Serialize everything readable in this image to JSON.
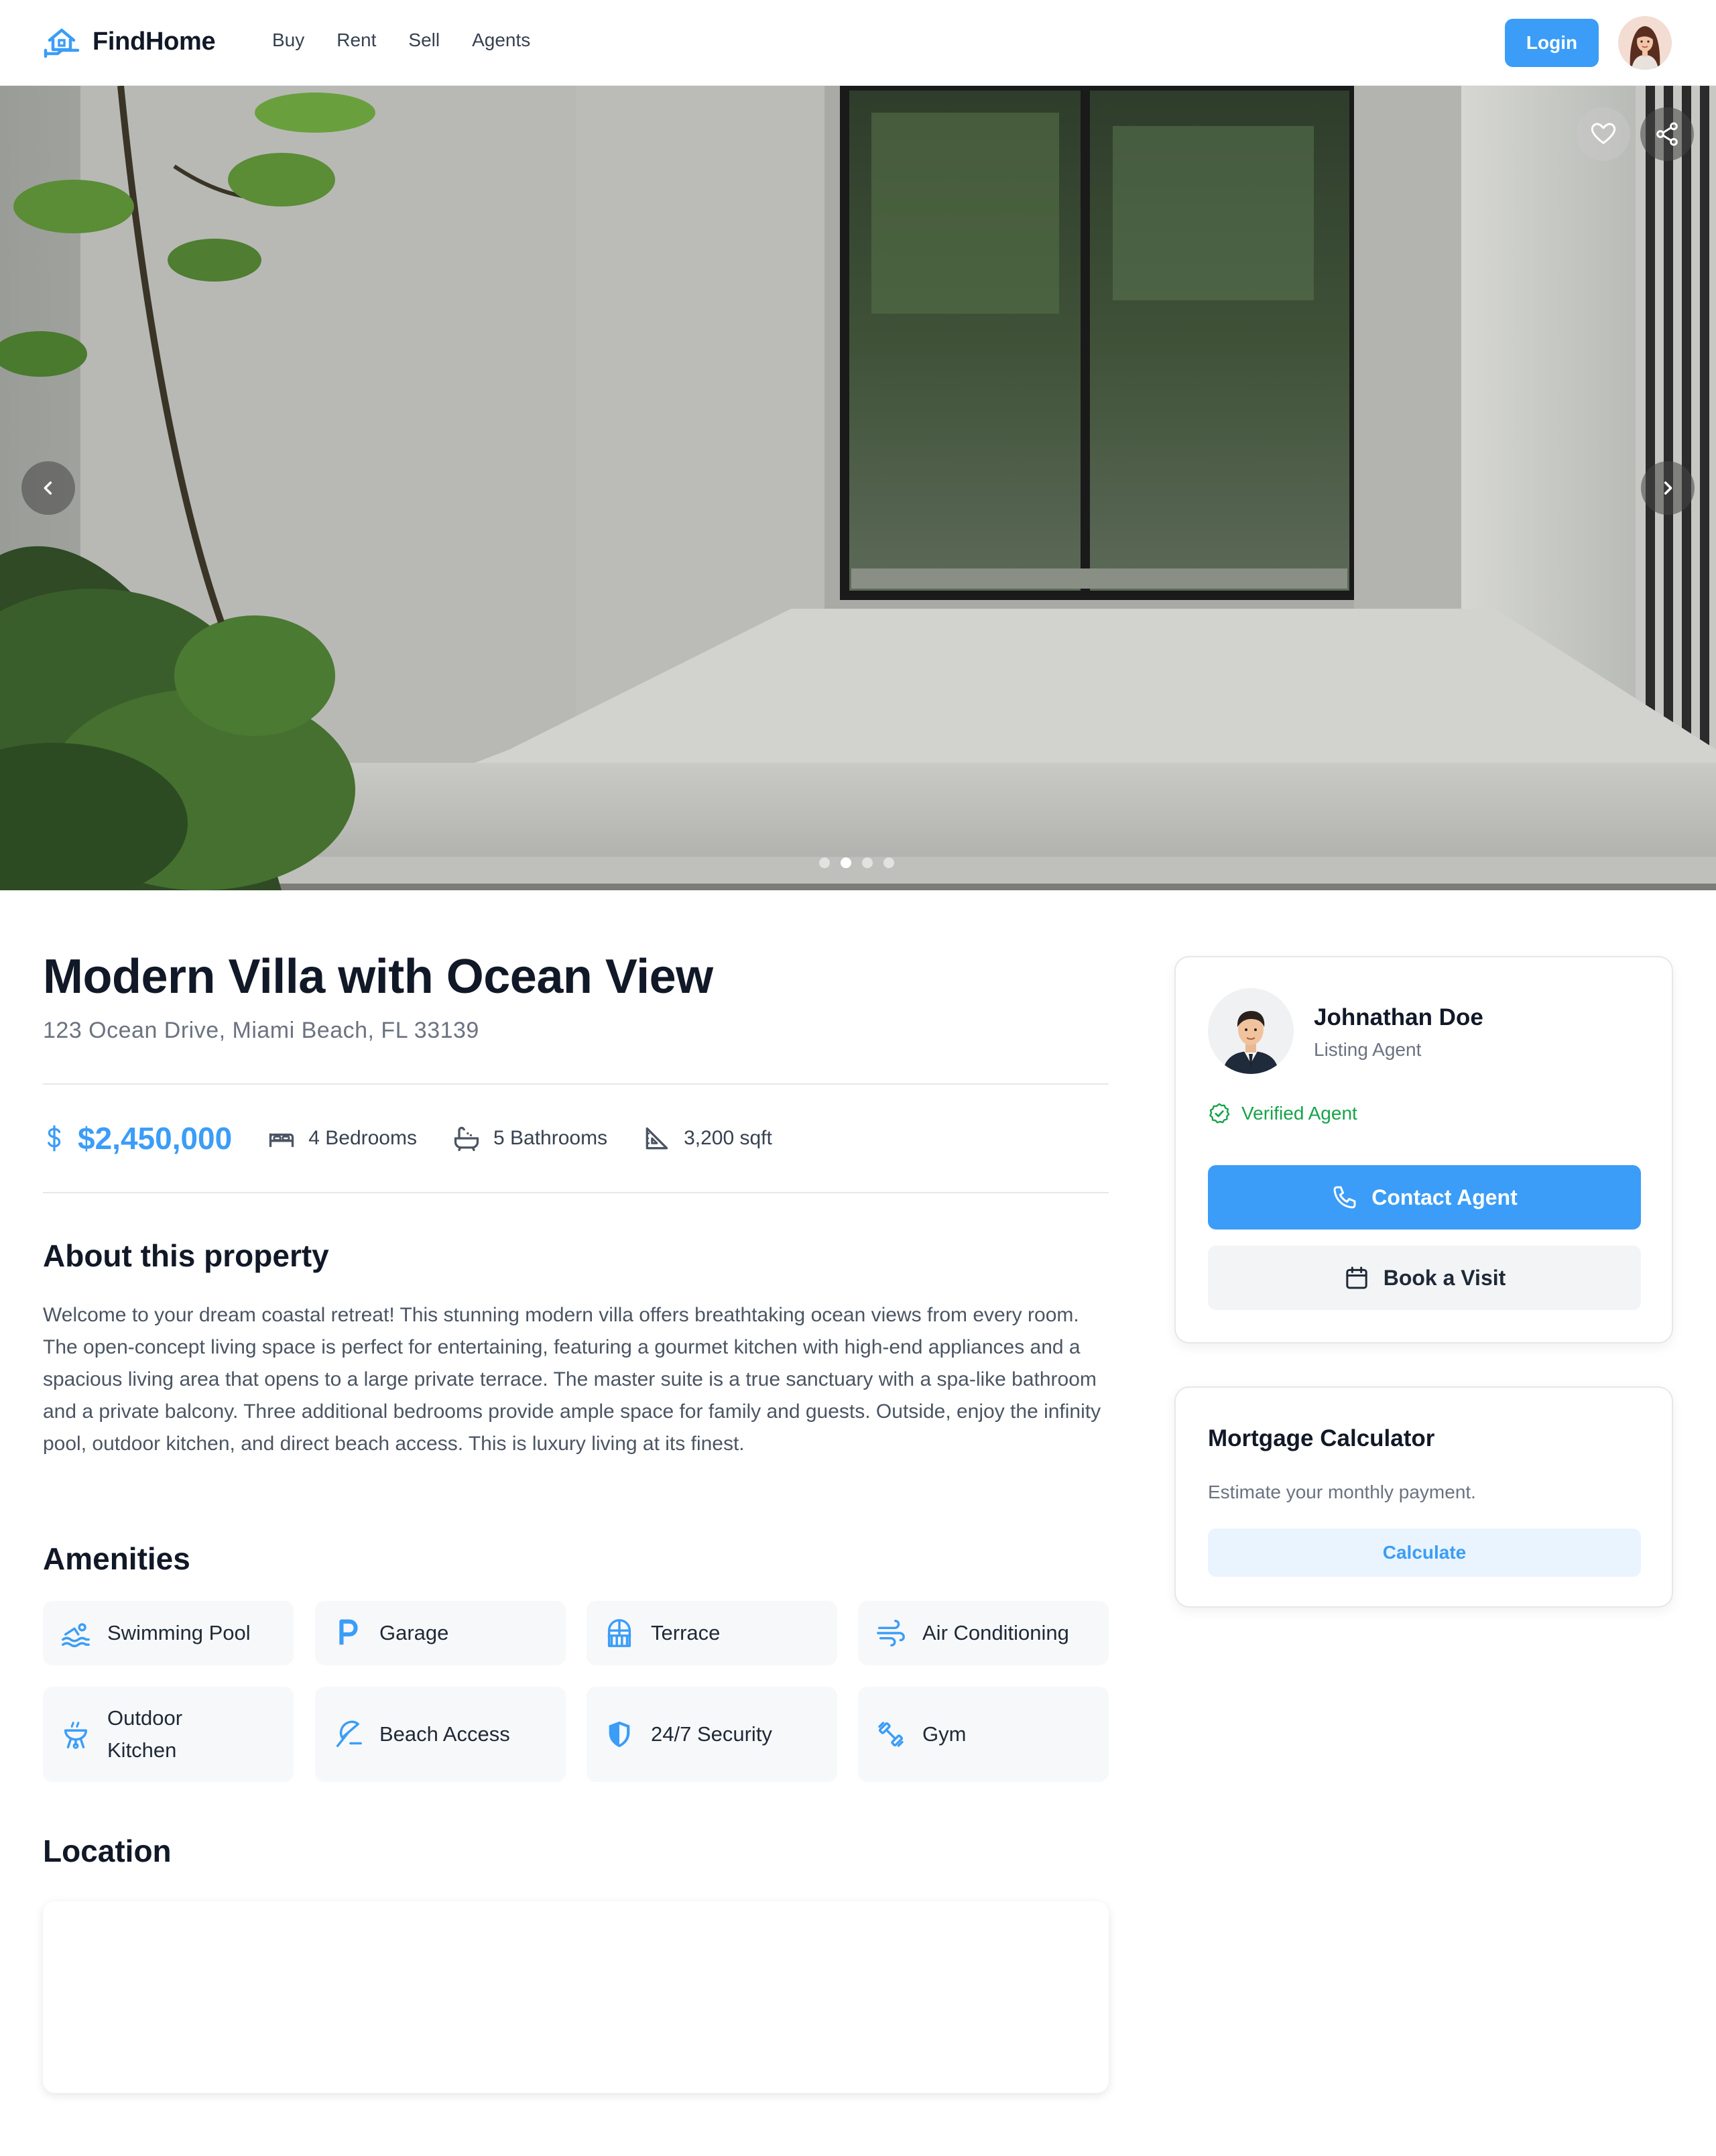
{
  "header": {
    "brand_name": "FindHome",
    "nav": [
      "Buy",
      "Rent",
      "Sell",
      "Agents"
    ],
    "login_label": "Login"
  },
  "hero": {
    "slide_count": 4,
    "active_slide_index": 1
  },
  "property": {
    "title": "Modern Villa with Ocean View",
    "address": "123 Ocean Drive, Miami Beach, FL 33139",
    "price": "$2,450,000",
    "bedrooms": "4 Bedrooms",
    "bathrooms": "5 Bathrooms",
    "area": "3,200 sqft"
  },
  "about": {
    "heading": "About this property",
    "text": "Welcome to your dream coastal retreat! This stunning modern villa offers breathtaking ocean views from every room. The open-concept living space is perfect for entertaining, featuring a gourmet kitchen with high-end appliances and a spacious living area that opens to a large private terrace. The master suite is a true sanctuary with a spa-like bathroom and a private balcony. Three additional bedrooms provide ample space for family and guests. Outside, enjoy the infinity pool, outdoor kitchen, and direct beach access. This is luxury living at its finest."
  },
  "amenities": {
    "heading": "Amenities",
    "items": [
      {
        "label": "Swimming Pool",
        "icon": "pool-icon"
      },
      {
        "label": "Garage",
        "icon": "parking-icon"
      },
      {
        "label": "Terrace",
        "icon": "terrace-icon"
      },
      {
        "label": "Air Conditioning",
        "icon": "wind-icon"
      },
      {
        "label": "Outdoor Kitchen",
        "icon": "grill-icon"
      },
      {
        "label": "Beach Access",
        "icon": "umbrella-icon"
      },
      {
        "label": "24/7 Security",
        "icon": "shield-icon"
      },
      {
        "label": "Gym",
        "icon": "dumbbell-icon"
      }
    ]
  },
  "location": {
    "heading": "Location"
  },
  "agent": {
    "name": "Johnathan Doe",
    "role": "Listing Agent",
    "verified_label": "Verified Agent",
    "contact_label": "Contact Agent",
    "visit_label": "Book a Visit"
  },
  "mortgage": {
    "title": "Mortgage Calculator",
    "subtitle": "Estimate your monthly payment.",
    "button_label": "Calculate"
  },
  "colors": {
    "accent": "#3b9df7",
    "verified": "#16a34a",
    "heading": "#111827",
    "body_text": "#4b5563"
  }
}
